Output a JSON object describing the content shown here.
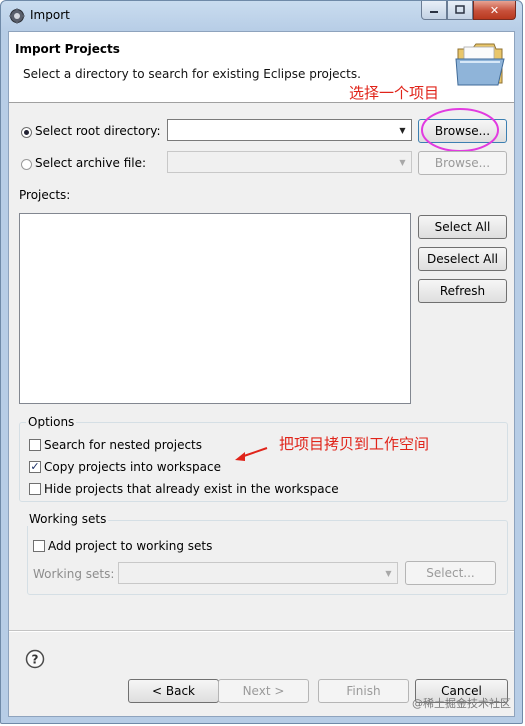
{
  "window": {
    "title": "Import",
    "controls": {
      "minimize": "▭",
      "maximize": "□",
      "close": "✕"
    }
  },
  "header": {
    "title": "Import Projects",
    "description": "Select a directory to search for existing Eclipse projects."
  },
  "annotations": {
    "select_project": "选择一个项目",
    "copy_to_workspace": "把项目拷贝到工作空间",
    "color": "#e0241a",
    "circle_color": "#e23be0"
  },
  "source": {
    "root_directory_label": "Select root directory:",
    "root_directory_value": "",
    "root_directory_selected": true,
    "archive_file_label": "Select archive file:",
    "archive_file_value": "",
    "browse_label": "Browse...",
    "browse_archive_label": "Browse..."
  },
  "projects": {
    "label": "Projects:",
    "items": [],
    "select_all": "Select All",
    "deselect_all": "Deselect All",
    "refresh": "Refresh"
  },
  "options": {
    "title": "Options",
    "search_nested": {
      "label": "Search for nested projects",
      "checked": false
    },
    "copy_into_workspace": {
      "label": "Copy projects into workspace",
      "checked": true
    },
    "hide_existing": {
      "label": "Hide projects that already exist in the workspace",
      "checked": false
    }
  },
  "working_sets": {
    "title": "Working sets",
    "add_to_working_sets": {
      "label": "Add project to working sets",
      "checked": false
    },
    "working_sets_label": "Working sets:",
    "working_sets_value": "",
    "select_label": "Select..."
  },
  "footer": {
    "help_icon": "?",
    "back": "< Back",
    "next": "Next >",
    "finish": "Finish",
    "cancel": "Cancel"
  },
  "watermark": "@稀土掘金技术社区"
}
